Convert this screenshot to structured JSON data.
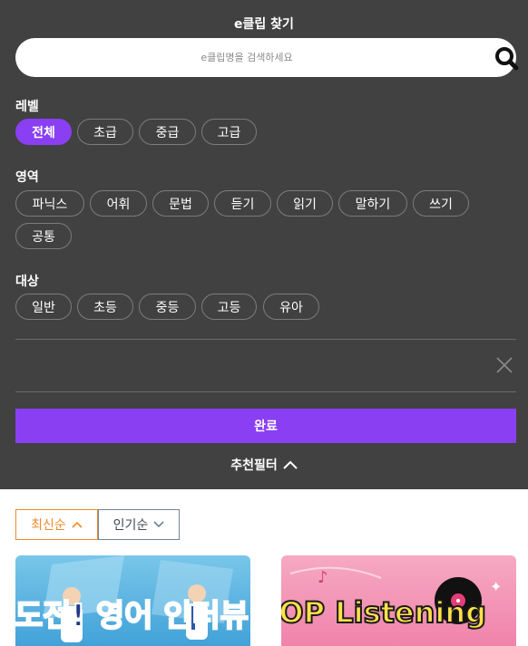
{
  "panel": {
    "title": "e클립 찾기",
    "search_placeholder": "e클립명을 검색하세요",
    "done_label": "완료",
    "recommend_label": "추천필터"
  },
  "level": {
    "label": "레벨",
    "options": [
      "전체",
      "초급",
      "중급",
      "고급"
    ],
    "selected": "전체"
  },
  "area": {
    "label": "영역",
    "options": [
      "파닉스",
      "어휘",
      "문법",
      "듣기",
      "읽기",
      "말하기",
      "쓰기",
      "공통"
    ]
  },
  "target": {
    "label": "대상",
    "options": [
      "일반",
      "초등",
      "중등",
      "고등",
      "유아"
    ]
  },
  "sort": {
    "latest": "최신순",
    "popular": "인기순",
    "active": "최신순"
  },
  "cards": [
    {
      "thumb_text": "도전! 영어 인터뷰"
    },
    {
      "thumb_text": "POP Listening"
    }
  ],
  "colors": {
    "panel_bg": "#414141",
    "accent": "#8a3ff2",
    "sort_active": "#f08a2a",
    "sort_inactive": "#6f8596"
  }
}
